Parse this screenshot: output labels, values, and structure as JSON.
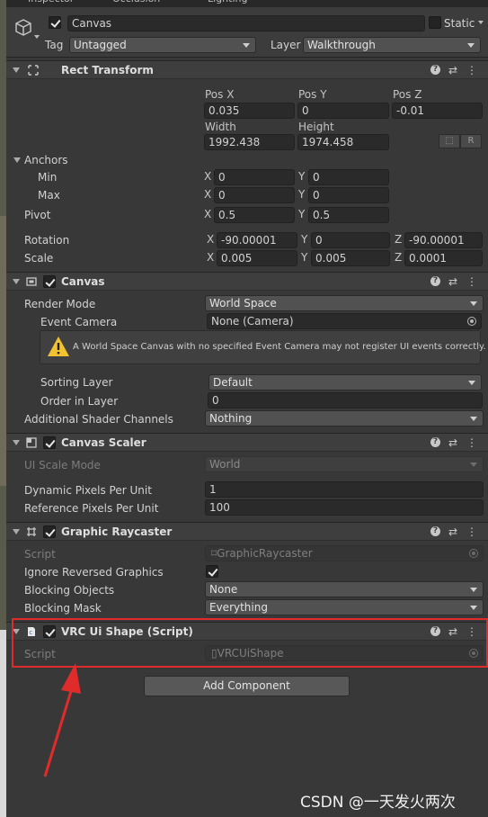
{
  "tabs": [
    "Inspector",
    "Occlusion",
    "Lighting"
  ],
  "object": {
    "active_checked": true,
    "name": "Canvas",
    "static_label": "Static",
    "static_checked": false,
    "tag_label": "Tag",
    "tag_value": "Untagged",
    "layer_label": "Layer",
    "layer_value": "Walkthrough"
  },
  "rect_transform": {
    "title": "Rect Transform",
    "pos_x_label": "Pos X",
    "pos_y_label": "Pos Y",
    "pos_z_label": "Pos Z",
    "pos_x": "0.035",
    "pos_y": "0",
    "pos_z": "-0.01",
    "width_label": "Width",
    "height_label": "Height",
    "width": "1992.438",
    "height": "1974.458",
    "raw_button": "R",
    "anchors_label": "Anchors",
    "min_label": "Min",
    "max_label": "Max",
    "min_x": "0",
    "min_y": "0",
    "max_x": "0",
    "max_y": "0",
    "pivot_label": "Pivot",
    "pivot_x": "0.5",
    "pivot_y": "0.5",
    "rotation_label": "Rotation",
    "rot_x": "-90.00001",
    "rot_y": "0",
    "rot_z": "-90.00001",
    "scale_label": "Scale",
    "scale_x": "0.005",
    "scale_y": "0.005",
    "scale_z": "0.0001",
    "axis_x": "X",
    "axis_y": "Y",
    "axis_z": "Z"
  },
  "canvas": {
    "title": "Canvas",
    "enabled": true,
    "render_mode_label": "Render Mode",
    "render_mode": "World Space",
    "event_camera_label": "Event Camera",
    "event_camera": "None (Camera)",
    "warning": "A World Space Canvas with no specified Event Camera may not register UI events correctly.",
    "sorting_layer_label": "Sorting Layer",
    "sorting_layer": "Default",
    "order_label": "Order in Layer",
    "order": "0",
    "shader_channels_label": "Additional Shader Channels",
    "shader_channels": "Nothing"
  },
  "canvas_scaler": {
    "title": "Canvas Scaler",
    "enabled": true,
    "scale_mode_label": "UI Scale Mode",
    "scale_mode": "World",
    "dynamic_label": "Dynamic Pixels Per Unit",
    "dynamic": "1",
    "reference_label": "Reference Pixels Per Unit",
    "reference": "100"
  },
  "graphic_raycaster": {
    "title": "Graphic Raycaster",
    "enabled": true,
    "script_label": "Script",
    "script": "GraphicRaycaster",
    "ignore_label": "Ignore Reversed Graphics",
    "ignore_checked": true,
    "blocking_objects_label": "Blocking Objects",
    "blocking_objects": "None",
    "blocking_mask_label": "Blocking Mask",
    "blocking_mask": "Everything"
  },
  "vrc_ui_shape": {
    "title": "VRC Ui Shape (Script)",
    "enabled": true,
    "script_label": "Script",
    "script": "VRCUiShape"
  },
  "add_component": "Add Component",
  "watermark": "CSDN @一天发火两次",
  "colors": {
    "highlight_red": "#e02b2b",
    "panel_bg": "#383838"
  },
  "icons": [
    "gameobject-cube-icon",
    "rect-transform-icon",
    "canvas-icon",
    "canvas-scaler-icon",
    "raycaster-icon",
    "script-icon",
    "help-icon",
    "presets-icon",
    "menu-dots-icon",
    "warning-icon",
    "object-picker-icon"
  ]
}
